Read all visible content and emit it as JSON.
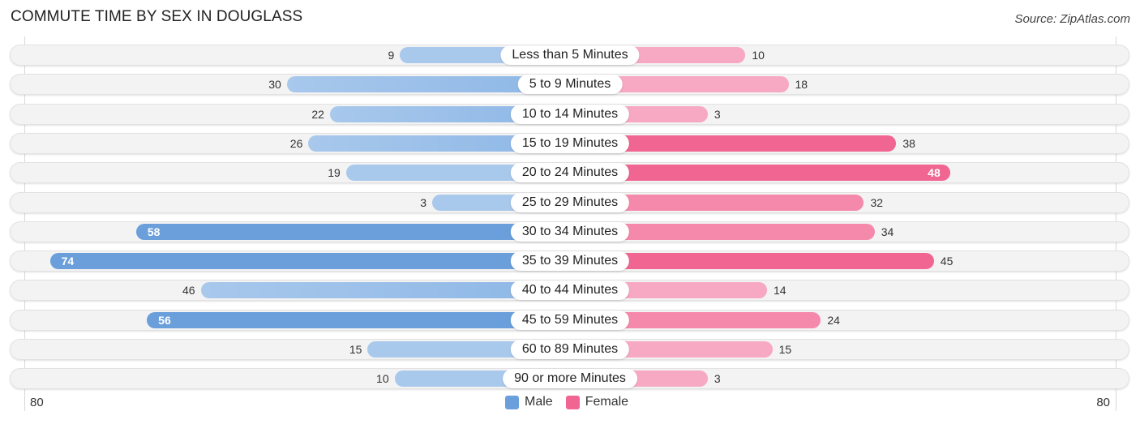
{
  "header": {
    "title": "COMMUTE TIME BY SEX IN DOUGLASS",
    "source": "Source: ZipAtlas.com"
  },
  "colors": {
    "male": "#6a9fdc",
    "male_light": "#a8c8ec",
    "female": "#f06592",
    "female_light": "#f7a8c2"
  },
  "chart_data": {
    "type": "bar",
    "orientation": "horizontal-diverging",
    "title": "COMMUTE TIME BY SEX IN DOUGLASS",
    "categories": [
      "Less than 5 Minutes",
      "5 to 9 Minutes",
      "10 to 14 Minutes",
      "15 to 19 Minutes",
      "20 to 24 Minutes",
      "25 to 29 Minutes",
      "30 to 34 Minutes",
      "35 to 39 Minutes",
      "40 to 44 Minutes",
      "45 to 59 Minutes",
      "60 to 89 Minutes",
      "90 or more Minutes"
    ],
    "series": [
      {
        "name": "Male",
        "values": [
          9,
          30,
          22,
          26,
          19,
          3,
          58,
          74,
          46,
          56,
          15,
          10
        ]
      },
      {
        "name": "Female",
        "values": [
          10,
          18,
          3,
          38,
          48,
          32,
          34,
          45,
          14,
          24,
          15,
          3
        ]
      }
    ],
    "axis": {
      "left_label": "80",
      "right_label": "80",
      "max": 80
    },
    "legend": {
      "position": "bottom-center",
      "items": [
        "Male",
        "Female"
      ]
    }
  }
}
